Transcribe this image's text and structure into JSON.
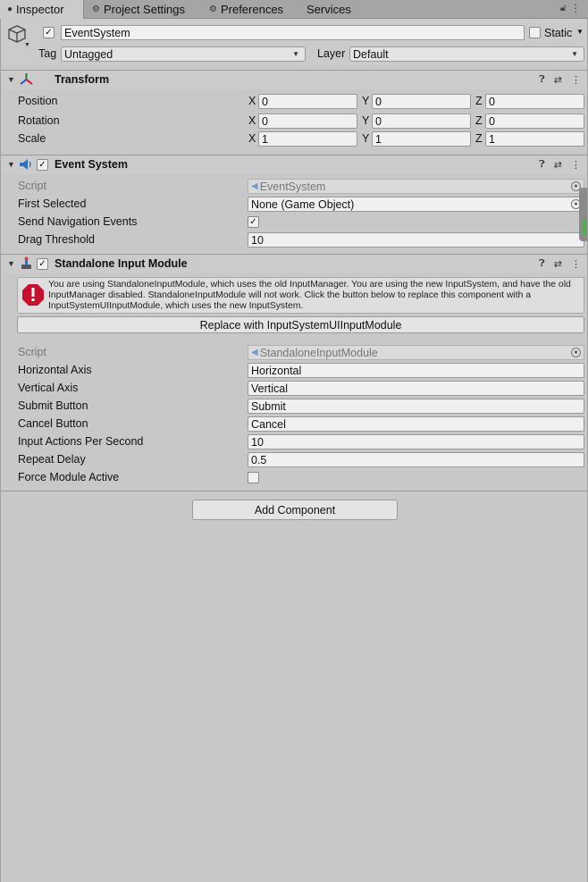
{
  "tabs": [
    {
      "label": "Inspector",
      "icon": "info-icon"
    },
    {
      "label": "Project Settings",
      "icon": "gear-icon"
    },
    {
      "label": "Preferences",
      "icon": "gear-icon"
    },
    {
      "label": "Services",
      "icon": ""
    }
  ],
  "gameobject": {
    "name": "EventSystem",
    "active": true,
    "static_label": "Static",
    "tag_label": "Tag",
    "tag_value": "Untagged",
    "layer_label": "Layer",
    "layer_value": "Default"
  },
  "transform": {
    "title": "Transform",
    "position": {
      "label": "Position",
      "x": "0",
      "y": "0",
      "z": "0"
    },
    "rotation": {
      "label": "Rotation",
      "x": "0",
      "y": "0",
      "z": "0"
    },
    "scale": {
      "label": "Scale",
      "x": "1",
      "y": "1",
      "z": "1"
    },
    "x_label": "X",
    "y_label": "Y",
    "z_label": "Z"
  },
  "event_system": {
    "title": "Event System",
    "enabled": true,
    "script_label": "Script",
    "script_value": "EventSystem",
    "first_selected_label": "First Selected",
    "first_selected_value": "None (Game Object)",
    "send_nav_label": "Send Navigation Events",
    "send_nav_checked": true,
    "drag_threshold_label": "Drag Threshold",
    "drag_threshold_value": "10"
  },
  "standalone": {
    "title": "Standalone Input Module",
    "enabled": true,
    "warning": "You are using StandaloneInputModule, which uses the old InputManager. You are using the new InputSystem, and have the old InputManager disabled. StandaloneInputModule will not work. Click the button below to replace this component with a InputSystemUIInputModule, which uses the new InputSystem.",
    "replace_button": "Replace with InputSystemUIInputModule",
    "script_label": "Script",
    "script_value": "StandaloneInputModule",
    "fields": [
      {
        "label": "Horizontal Axis",
        "value": "Horizontal"
      },
      {
        "label": "Vertical Axis",
        "value": "Vertical"
      },
      {
        "label": "Submit Button",
        "value": "Submit"
      },
      {
        "label": "Cancel Button",
        "value": "Cancel"
      },
      {
        "label": "Input Actions Per Second",
        "value": "10"
      },
      {
        "label": "Repeat Delay",
        "value": "0.5"
      }
    ],
    "force_label": "Force Module Active",
    "force_checked": false
  },
  "add_component": "Add Component",
  "colors": {
    "background": "#c8c8c8",
    "tabbar": "#a5a5a5",
    "warning_red": "#c8102e"
  }
}
